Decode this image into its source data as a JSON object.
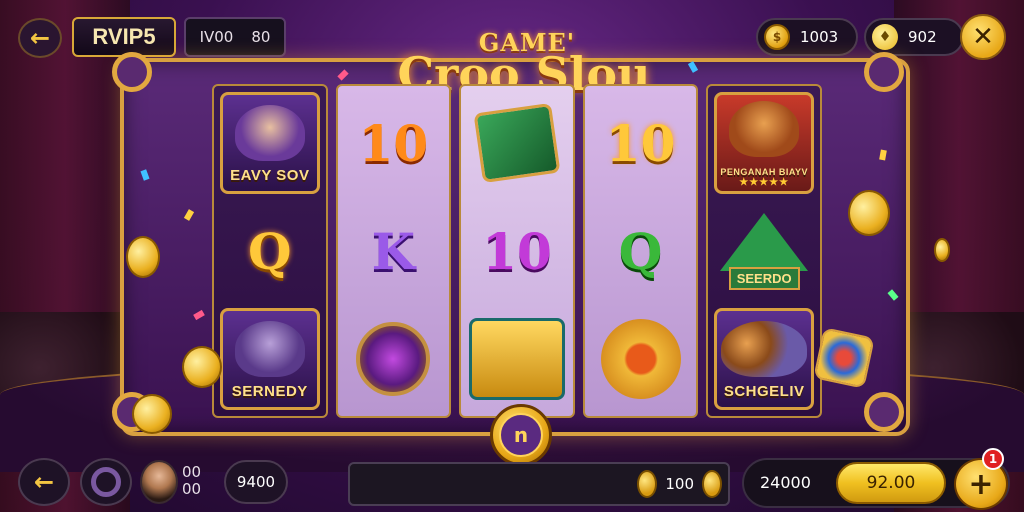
{
  "header": {
    "back_icon": "arrow-left-icon",
    "vip_label": "RVIP5",
    "level_left": "IV00",
    "level_right": "80",
    "coins": "1003",
    "gems": "902",
    "close_icon": "close-icon"
  },
  "game": {
    "logo_top": "GAME'",
    "logo_main": "Croo Slou"
  },
  "reels": [
    {
      "style": "dark",
      "cells": [
        {
          "kind": "character",
          "name": "EAVY SOV",
          "icon": "jester-character-icon"
        },
        {
          "kind": "letter",
          "text": "Q",
          "color": "gold"
        },
        {
          "kind": "character",
          "name": "SERNEDY",
          "icon": "wolf-character-icon"
        }
      ]
    },
    {
      "style": "light",
      "cells": [
        {
          "kind": "letter",
          "text": "10",
          "color": "orange"
        },
        {
          "kind": "letter",
          "text": "K",
          "color": "purple"
        },
        {
          "kind": "symbol",
          "icon": "purple-pot-icon"
        }
      ]
    },
    {
      "style": "mid",
      "cells": [
        {
          "kind": "symbol",
          "icon": "green-box-icon"
        },
        {
          "kind": "letter",
          "text": "10",
          "color": "magenta"
        },
        {
          "kind": "symbol",
          "icon": "treasure-chest-icon"
        }
      ]
    },
    {
      "style": "light",
      "cells": [
        {
          "kind": "letter",
          "text": "10",
          "color": "gold"
        },
        {
          "kind": "letter",
          "text": "Q",
          "color": "green"
        },
        {
          "kind": "symbol",
          "icon": "golden-flower-icon"
        }
      ]
    },
    {
      "style": "dark",
      "cells": [
        {
          "kind": "character",
          "name": "PENGANAH BIAYV",
          "icon": "fox-warrior-icon",
          "stars": "★★★★★"
        },
        {
          "kind": "symbol",
          "icon": "pyramid-bonus-icon",
          "text": "SEERDO"
        },
        {
          "kind": "character",
          "name": "SCHGELIV",
          "icon": "dog-duo-character-icon"
        }
      ]
    }
  ],
  "spin": {
    "label": "n"
  },
  "footer": {
    "back_icon": "arrow-left-icon",
    "menu_icon": "ring-icon",
    "player_stat_top": "00",
    "player_stat_bottom": "00",
    "player_score": "9400",
    "bet_value": "100",
    "balance": "24000",
    "win_amount": "92.00",
    "add_icon": "plus-icon",
    "notification_count": "1"
  },
  "colors": {
    "gold": "#ffc83a",
    "background": "#3a1050",
    "frame": "#d8a040"
  }
}
